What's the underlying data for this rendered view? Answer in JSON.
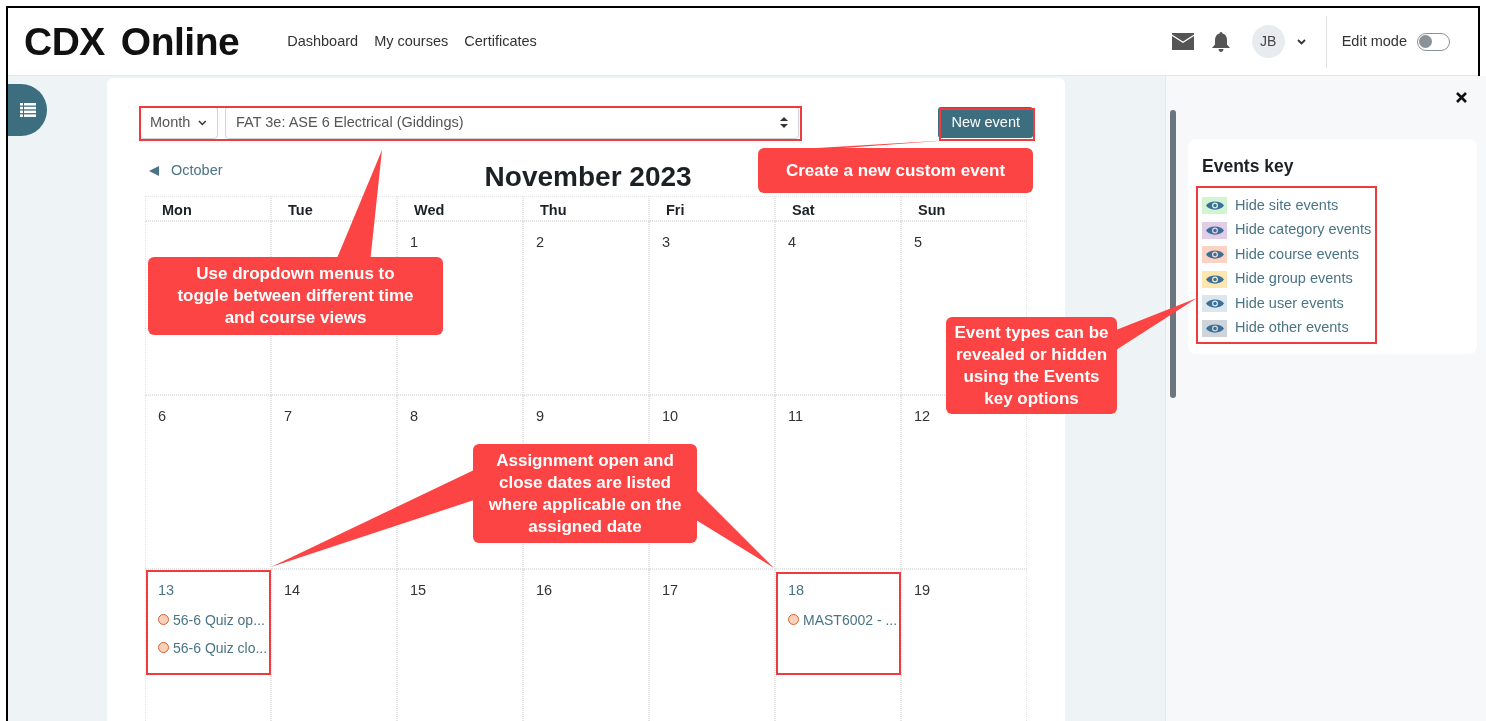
{
  "navbar": {
    "brand": "CDX",
    "product": "Online",
    "links": [
      "Dashboard",
      "My courses",
      "Certificates"
    ],
    "avatar": "JB",
    "edit_mode": {
      "label": "Edit mode",
      "on": false
    }
  },
  "calendar": {
    "view": "Month",
    "course": "FAT 3e: ASE 6 Electrical (Giddings)",
    "new_event": "New event",
    "previous": "October",
    "title": "November 2023",
    "weekdays": [
      "Mon",
      "Tue",
      "Wed",
      "Thu",
      "Fri",
      "Sat",
      "Sun"
    ],
    "weeks": [
      [
        {
          "day": "1"
        },
        {
          "day": "2"
        },
        {
          "day": "3"
        },
        {
          "day": "4"
        },
        {
          "day": "5"
        }
      ],
      [
        {
          "day": "6"
        },
        {
          "day": "7"
        },
        {
          "day": "8"
        },
        {
          "day": "9"
        },
        {
          "day": "10"
        },
        {
          "day": "11"
        },
        {
          "day": "12"
        }
      ],
      [
        {
          "day": "13",
          "events": [
            {
              "title": "56-6 Quiz op..."
            },
            {
              "title": "56-6 Quiz clo..."
            }
          ]
        },
        {
          "day": "14"
        },
        {
          "day": "15"
        },
        {
          "day": "16"
        },
        {
          "day": "17"
        },
        {
          "day": "18",
          "events": [
            {
              "title": "MAST6002 - ..."
            }
          ]
        },
        {
          "day": "19"
        }
      ]
    ]
  },
  "events_key": {
    "title": "Events key",
    "items": [
      {
        "label": "Hide site events",
        "color": "#d2f4d2"
      },
      {
        "label": "Hide category events",
        "color": "#e2cde6"
      },
      {
        "label": "Hide course events",
        "color": "#fcd3c2"
      },
      {
        "label": "Hide group events",
        "color": "#fde6b0"
      },
      {
        "label": "Hide user events",
        "color": "#dbe6ee"
      },
      {
        "label": "Hide other events",
        "color": "#ced4da"
      }
    ]
  },
  "annotations": [
    {
      "text": "Use dropdown menus to toggle between different time and course views"
    },
    {
      "text": "Create a new custom event"
    },
    {
      "text": "Event types can be revealed or hidden using the Events key options"
    },
    {
      "text": "Assignment open and close dates are listed where applicable on the assigned date"
    }
  ]
}
